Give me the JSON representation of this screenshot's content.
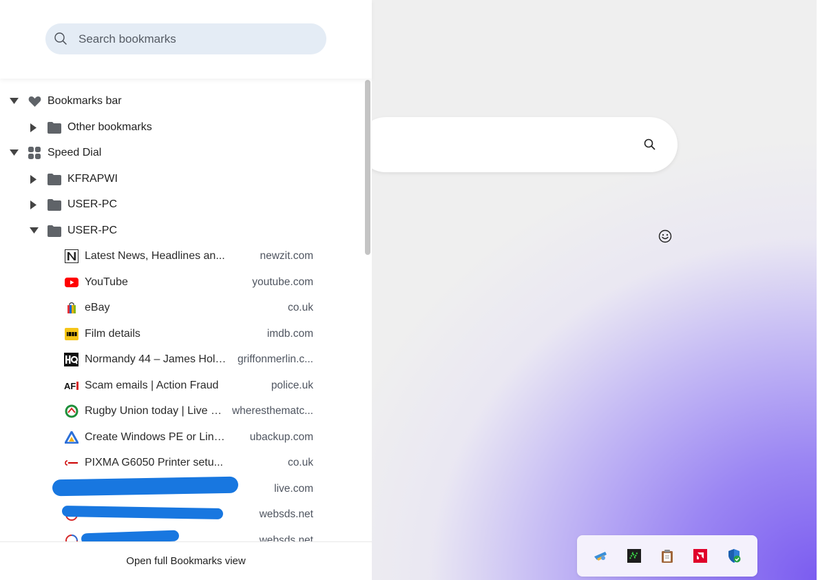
{
  "bookmarks_panel": {
    "search": {
      "placeholder": "Search bookmarks",
      "value": ""
    },
    "tree": {
      "bookmarks_bar": {
        "label": "Bookmarks bar",
        "icon": "heart-icon",
        "expanded": true
      },
      "other_bookmarks": {
        "label": "Other bookmarks",
        "icon": "folder-icon",
        "expanded": false
      },
      "speed_dial": {
        "label": "Speed Dial",
        "icon": "grid-icon",
        "expanded": true
      },
      "folders": [
        {
          "label": "KFRAPWI",
          "expanded": false
        },
        {
          "label": "USER-PC",
          "expanded": false
        },
        {
          "label": "USER-PC",
          "expanded": true
        }
      ],
      "bookmarks": [
        {
          "title": "Latest News, Headlines an...",
          "domain": "newzit.com",
          "icon": "newzit-favicon"
        },
        {
          "title": "YouTube",
          "domain": "youtube.com",
          "icon": "youtube-favicon"
        },
        {
          "title": "eBay",
          "domain": "co.uk",
          "icon": "ebay-favicon"
        },
        {
          "title": "Film details",
          "domain": "imdb.com",
          "icon": "imdb-favicon"
        },
        {
          "title": "Normandy 44 – James Holl...",
          "domain": "griffonmerlin.c...",
          "icon": "hq-favicon"
        },
        {
          "title": "Scam emails | Action Fraud",
          "domain": "police.uk",
          "icon": "action-fraud-favicon"
        },
        {
          "title": "Rugby Union today | Live R...",
          "domain": "wheresthematc...",
          "icon": "wheresthematch-favicon"
        },
        {
          "title": "Create Windows PE or Linu...",
          "domain": "ubackup.com",
          "icon": "ubackup-favicon"
        },
        {
          "title": "PIXMA G6050 Printer setu...",
          "domain": "co.uk",
          "icon": "canon-favicon"
        },
        {
          "title": "",
          "domain": "live.com",
          "icon": "outlook-favicon"
        },
        {
          "title": "",
          "domain": "websds.net",
          "icon": "websds-favicon"
        },
        {
          "title": "",
          "domain": "websds.net",
          "icon": "websds-favicon"
        }
      ]
    },
    "footer": {
      "link": "Open full Bookmarks view"
    }
  },
  "start_page": {
    "search_icon": "search-icon",
    "emoji_icon": "smiley-icon",
    "dock": [
      "app-icon-1",
      "app-icon-2",
      "clipboard-icon",
      "amd-icon",
      "security-shield-icon"
    ]
  },
  "colors": {
    "search_bg": "#e4ecf5",
    "youtube_red": "#ff0000",
    "imdb_yellow": "#f5c518",
    "redaction_blue": "#1877e0",
    "accent_purple": "#7b5cf0"
  }
}
